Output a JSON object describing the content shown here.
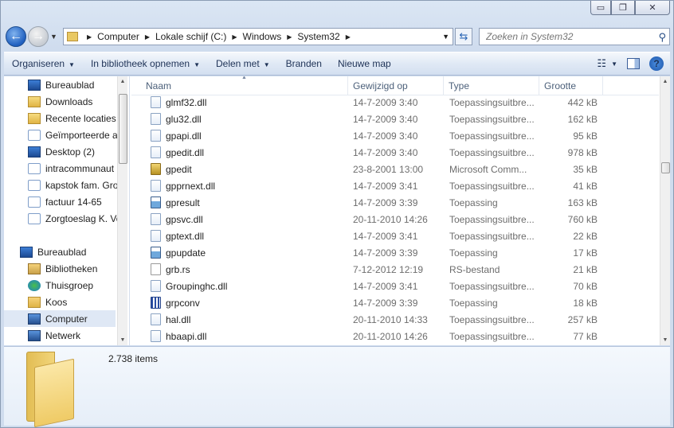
{
  "window": {
    "controls": [
      {
        "name": "minimize-button",
        "glyph": "▭"
      },
      {
        "name": "maximize-button",
        "glyph": "❐"
      },
      {
        "name": "close-button",
        "glyph": "✕"
      }
    ]
  },
  "address": {
    "crumbs": [
      "Computer",
      "Lokale schijf (C:)",
      "Windows",
      "System32"
    ]
  },
  "search": {
    "placeholder": "Zoeken in System32"
  },
  "toolbar": {
    "items": [
      {
        "label": "Organiseren",
        "has_arrow": true
      },
      {
        "label": "In bibliotheek opnemen",
        "has_arrow": true
      },
      {
        "label": "Delen met",
        "has_arrow": true
      },
      {
        "label": "Branden",
        "has_arrow": false
      },
      {
        "label": "Nieuwe map",
        "has_arrow": false
      }
    ]
  },
  "nav": {
    "favorites": [
      {
        "label": "Bureaublad",
        "icon": "desktop-icon"
      },
      {
        "label": "Downloads",
        "icon": "downloads-folder-icon"
      },
      {
        "label": "Recente locaties",
        "icon": "recent-places-icon"
      },
      {
        "label": "Geïmporteerde af",
        "icon": "document-icon"
      },
      {
        "label": "Desktop (2)",
        "icon": "desktop-icon"
      },
      {
        "label": "intracommunaut",
        "icon": "document-icon"
      },
      {
        "label": "kapstok fam. Gro",
        "icon": "document-icon"
      },
      {
        "label": "factuur 14-65",
        "icon": "document-icon"
      },
      {
        "label": "Zorgtoeslag K. Vo",
        "icon": "document-icon"
      }
    ],
    "tree": [
      {
        "label": "Bureaublad",
        "icon": "desktop-icon",
        "indent": 0,
        "selected": false
      },
      {
        "label": "Bibliotheken",
        "icon": "libraries-icon",
        "indent": 1,
        "selected": false
      },
      {
        "label": "Thuisgroep",
        "icon": "homegroup-icon",
        "indent": 1,
        "selected": false
      },
      {
        "label": "Koos",
        "icon": "user-folder-icon",
        "indent": 1,
        "selected": false
      },
      {
        "label": "Computer",
        "icon": "computer-icon",
        "indent": 1,
        "selected": true
      },
      {
        "label": "Netwerk",
        "icon": "network-icon",
        "indent": 1,
        "selected": false
      }
    ]
  },
  "columns": [
    "Naam",
    "Gewijzigd op",
    "Type",
    "Grootte"
  ],
  "files": [
    {
      "name": "glmf32.dll",
      "date": "14-7-2009 3:40",
      "type": "Toepassingsuitbre...",
      "size": "442 kB",
      "icon": "dll-file-icon"
    },
    {
      "name": "glu32.dll",
      "date": "14-7-2009 3:40",
      "type": "Toepassingsuitbre...",
      "size": "162 kB",
      "icon": "dll-file-icon"
    },
    {
      "name": "gpapi.dll",
      "date": "14-7-2009 3:40",
      "type": "Toepassingsuitbre...",
      "size": "95 kB",
      "icon": "dll-file-icon"
    },
    {
      "name": "gpedit.dll",
      "date": "14-7-2009 3:40",
      "type": "Toepassingsuitbre...",
      "size": "978 kB",
      "icon": "dll-file-icon"
    },
    {
      "name": "gpedit",
      "date": "23-8-2001 13:00",
      "type": "Microsoft Comm...",
      "size": "35 kB",
      "icon": "msc-file-icon"
    },
    {
      "name": "gpprnext.dll",
      "date": "14-7-2009 3:41",
      "type": "Toepassingsuitbre...",
      "size": "41 kB",
      "icon": "dll-file-icon"
    },
    {
      "name": "gpresult",
      "date": "14-7-2009 3:39",
      "type": "Toepassing",
      "size": "163 kB",
      "icon": "exe-file-icon"
    },
    {
      "name": "gpsvc.dll",
      "date": "20-11-2010 14:26",
      "type": "Toepassingsuitbre...",
      "size": "760 kB",
      "icon": "dll-file-icon"
    },
    {
      "name": "gptext.dll",
      "date": "14-7-2009 3:41",
      "type": "Toepassingsuitbre...",
      "size": "22 kB",
      "icon": "dll-file-icon"
    },
    {
      "name": "gpupdate",
      "date": "14-7-2009 3:39",
      "type": "Toepassing",
      "size": "17 kB",
      "icon": "exe-file-icon"
    },
    {
      "name": "grb.rs",
      "date": "7-12-2012 12:19",
      "type": "RS-bestand",
      "size": "21 kB",
      "icon": "rs-file-icon"
    },
    {
      "name": "Groupinghc.dll",
      "date": "14-7-2009 3:41",
      "type": "Toepassingsuitbre...",
      "size": "70 kB",
      "icon": "dll-file-icon"
    },
    {
      "name": "grpconv",
      "date": "14-7-2009 3:39",
      "type": "Toepassing",
      "size": "18 kB",
      "icon": "grpconv-exe-icon"
    },
    {
      "name": "hal.dll",
      "date": "20-11-2010 14:33",
      "type": "Toepassingsuitbre...",
      "size": "257 kB",
      "icon": "dll-file-icon"
    },
    {
      "name": "hbaapi.dll",
      "date": "20-11-2010 14:26",
      "type": "Toepassingsuitbre...",
      "size": "77 kB",
      "icon": "dll-file-icon"
    }
  ],
  "details": {
    "item_count": "2.738 items"
  }
}
